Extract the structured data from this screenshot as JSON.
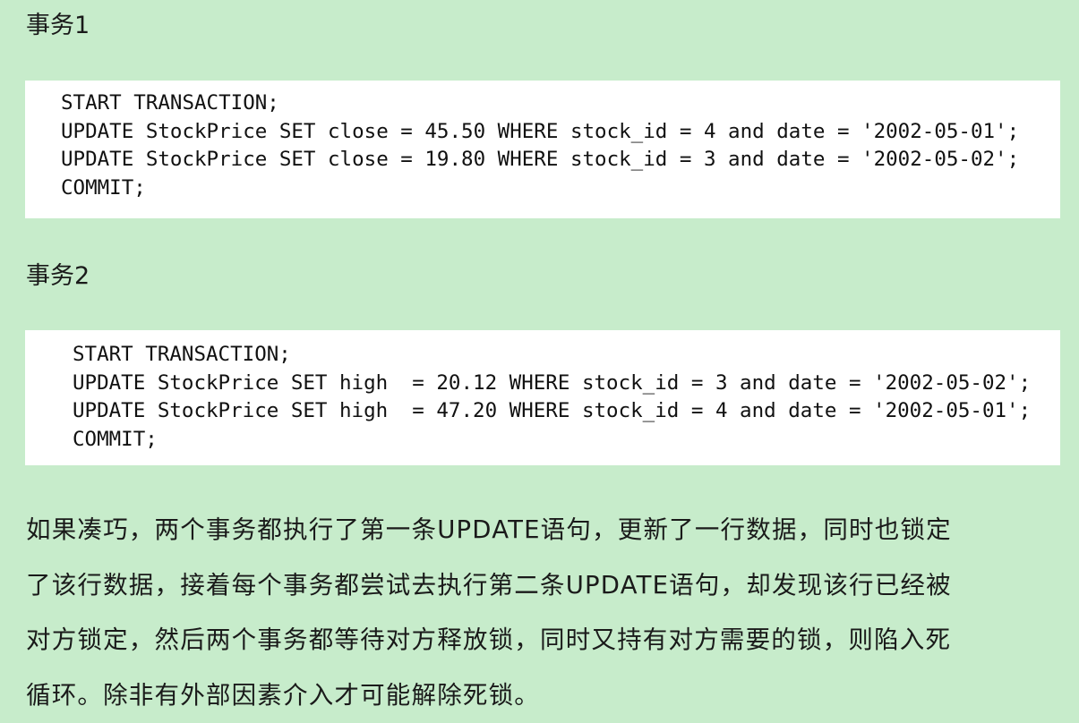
{
  "transaction1": {
    "title": "事务1",
    "code_lines": [
      "START TRANSACTION;",
      "UPDATE StockPrice SET close = 45.50 WHERE stock_id = 4 and date = '2002-05-01';",
      "UPDATE StockPrice SET close = 19.80 WHERE stock_id = 3 and date = '2002-05-02';",
      "COMMIT;"
    ]
  },
  "transaction2": {
    "title": "事务2",
    "code_lines": [
      "START TRANSACTION;",
      "UPDATE StockPrice SET high  = 20.12 WHERE stock_id = 3 and date = '2002-05-02';",
      "UPDATE StockPrice SET high  = 47.20 WHERE stock_id = 4 and date = '2002-05-01';",
      "COMMIT;"
    ]
  },
  "paragraph": {
    "lines": [
      "如果凑巧，两个事务都执行了第一条UPDATE语句，更新了一行数据，同时也锁定",
      "了该行数据，接着每个事务都尝试去执行第二条UPDATE语句，却发现该行已经被",
      "对方锁定，然后两个事务都等待对方释放锁，同时又持有对方需要的锁，则陷入死",
      "循环。除非有外部因素介入才可能解除死锁。"
    ]
  }
}
